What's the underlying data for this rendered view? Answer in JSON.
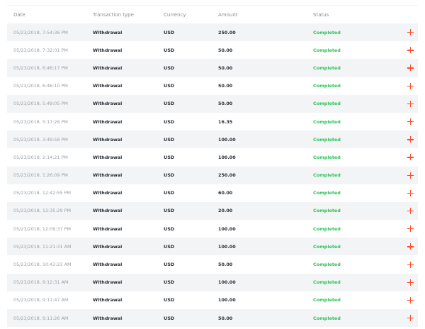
{
  "table": {
    "columns": {
      "date": "Date",
      "type": "Transaction type",
      "currency": "Currency",
      "amount": "Amount",
      "status": "Status"
    },
    "action_icon": "plus-icon",
    "colors": {
      "status_completed": "#2fc25b",
      "action": "#ff4b2b",
      "row_alt": "#f3f4f6"
    },
    "rows": [
      {
        "date": "05/23/2018, 7:54:36 PM",
        "type": "Withdrawal",
        "currency": "USD",
        "amount": "250.00",
        "status": "Completed"
      },
      {
        "date": "05/23/2018, 7:32:01 PM",
        "type": "Withdrawal",
        "currency": "USD",
        "amount": "50.00",
        "status": "Completed"
      },
      {
        "date": "05/23/2018, 6:46:17 PM",
        "type": "Withdrawal",
        "currency": "USD",
        "amount": "50.00",
        "status": "Completed"
      },
      {
        "date": "05/23/2018, 6:46:10 PM",
        "type": "Withdrawal",
        "currency": "USD",
        "amount": "50.00",
        "status": "Completed"
      },
      {
        "date": "05/23/2018, 5:49:05 PM",
        "type": "Withdrawal",
        "currency": "USD",
        "amount": "50.00",
        "status": "Completed"
      },
      {
        "date": "05/23/2018, 5:17:26 PM",
        "type": "Withdrawal",
        "currency": "USD",
        "amount": "16.35",
        "status": "Completed"
      },
      {
        "date": "05/23/2018, 3:49:58 PM",
        "type": "Withdrawal",
        "currency": "USD",
        "amount": "100.00",
        "status": "Completed"
      },
      {
        "date": "05/23/2018, 2:14:21 PM",
        "type": "Withdrawal",
        "currency": "USD",
        "amount": "100.00",
        "status": "Completed"
      },
      {
        "date": "05/23/2018, 1:26:09 PM",
        "type": "Withdrawal",
        "currency": "USD",
        "amount": "250.00",
        "status": "Completed"
      },
      {
        "date": "05/23/2018, 12:42:55 PM",
        "type": "Withdrawal",
        "currency": "USD",
        "amount": "60.00",
        "status": "Completed"
      },
      {
        "date": "05/23/2018, 12:35:29 PM",
        "type": "Withdrawal",
        "currency": "USD",
        "amount": "20.00",
        "status": "Completed"
      },
      {
        "date": "05/23/2018, 12:09:37 PM",
        "type": "Withdrawal",
        "currency": "USD",
        "amount": "100.00",
        "status": "Completed"
      },
      {
        "date": "05/23/2018, 11:21:31 AM",
        "type": "Withdrawal",
        "currency": "USD",
        "amount": "100.00",
        "status": "Completed"
      },
      {
        "date": "05/23/2018, 10:43:23 AM",
        "type": "Withdrawal",
        "currency": "USD",
        "amount": "50.00",
        "status": "Completed"
      },
      {
        "date": "05/23/2018, 9:12:31 AM",
        "type": "Withdrawal",
        "currency": "USD",
        "amount": "100.00",
        "status": "Completed"
      },
      {
        "date": "05/23/2018, 9:11:47 AM",
        "type": "Withdrawal",
        "currency": "USD",
        "amount": "100.00",
        "status": "Completed"
      },
      {
        "date": "05/23/2018, 9:11:26 AM",
        "type": "Withdrawal",
        "currency": "USD",
        "amount": "50.00",
        "status": "Completed"
      }
    ]
  }
}
